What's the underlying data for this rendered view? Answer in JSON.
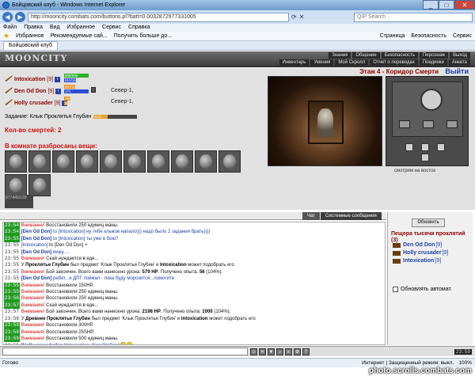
{
  "window": {
    "title": "Бойцовский клуб - Windows Internet Explorer",
    "address": "http://mooncity.combats.com/buttons.pl?batt=0.0032872977331005",
    "search_placeholder": "QIP Search",
    "menu": [
      "Файл",
      "Правка",
      "Вид",
      "Избранное",
      "Сервис",
      "Справка"
    ],
    "favorites": [
      "Избранное",
      "Рекомендуемые сай...",
      "Получить больше до..."
    ],
    "tab": "Бойцовский клуб",
    "cmds": [
      "Страница",
      "Безопасность",
      "Сервис"
    ]
  },
  "game": {
    "logo": "MOONCITY",
    "menu_row1": [
      "Знания",
      "Общение",
      "Безопасность",
      "Персонаж",
      "Выход"
    ],
    "menu_row2": [
      "Инвентарь",
      "Умения",
      "Мой Скролл",
      "Отчет о переводах",
      "Поединки",
      "Анкета"
    ],
    "location": "Этаж 4 - Коридор Смерти",
    "exit": "Выйти",
    "players": [
      {
        "name": "Intoxication",
        "level": "[9]",
        "hp": "899/899",
        "mp": "910/1915",
        "hp_pct": 100,
        "mp_pct": 48,
        "loc": ""
      },
      {
        "name": "Den Od Don",
        "level": "[9]",
        "hp": "602/1339",
        "mp": "171",
        "hp_pct": 45,
        "mp_pct": 100,
        "loc": "Север-1,"
      },
      {
        "name": "Holly crusader",
        "level": "[9]",
        "hp": "363/1400",
        "mp": "257/1800",
        "hp_pct": 26,
        "mp_pct": 14,
        "loc": "Север-1,"
      }
    ],
    "task_label": "Задание: Клык Проклятья Глубин",
    "task_progress": "5/15",
    "task_pct": 33,
    "deaths": "Кол-во смертей: 2",
    "scattered": "В комнате разбросаны вещи:",
    "item_count": 12,
    "coin_text": "977445/129",
    "facing": "смотрим на восток"
  },
  "chat": {
    "tabs": [
      "Чат",
      "Системные сообщения"
    ],
    "lines": [
      {
        "ts": "23:54",
        "g": true,
        "parts": [
          [
            "warn",
            "Внимание! "
          ],
          [
            "msgdark",
            "Восстановили 250 единиц маны."
          ]
        ]
      },
      {
        "ts": "23:54",
        "g": true,
        "parts": [
          [
            "nick",
            "[Den Od Don]"
          ],
          [
            "to",
            " to [Intoxication]"
          ],
          [
            "msgblue",
            " ну тебе клыков напало))) надо было 2 задания брать))))"
          ]
        ]
      },
      {
        "ts": "23:55",
        "g": true,
        "parts": [
          [
            "nick",
            "[Den Od Don]"
          ],
          [
            "to",
            " to [Intoxication]"
          ],
          [
            "msgblue",
            " ты уже в бою?"
          ]
        ]
      },
      {
        "ts": "23:55",
        "g": false,
        "parts": [
          [
            "to",
            "[Intoxication]"
          ],
          [
            "msgdark",
            " to [Den Od Don] +"
          ]
        ]
      },
      {
        "ts": "23:55",
        "g": false,
        "parts": [
          [
            "nick",
            "[Den Od Don]"
          ],
          [
            "msgblue",
            " вижу....."
          ]
        ]
      },
      {
        "ts": "23:55",
        "g": false,
        "parts": [
          [
            "warn",
            "Внимание! "
          ],
          [
            "msgdark",
            "Скай нуждается в еде..."
          ]
        ]
      },
      {
        "ts": "23:55",
        "g": false,
        "parts": [
          [
            "msgdark",
            "У "
          ],
          [
            "bold",
            "Проклятье Глубин"
          ],
          [
            "msgdark",
            " был предмет 'Клык Проклятья Глубин' и "
          ],
          [
            "bold",
            "Intoxication"
          ],
          [
            "msgdark",
            " может подобрать его"
          ]
        ]
      },
      {
        "ts": "23:55",
        "g": false,
        "parts": [
          [
            "warn",
            "Внимание! "
          ],
          [
            "msgdark",
            "Бой закончен. Всего вами нанесено урона: "
          ],
          [
            "bold",
            "579 HP"
          ],
          [
            "msgdark",
            ". Получено опыта: "
          ],
          [
            "bold",
            "56"
          ],
          [
            "msgdark",
            " (104%)."
          ]
        ]
      },
      {
        "ts": "23:55",
        "g": false,
        "parts": [
          [
            "nick",
            "[Den Od Don]"
          ],
          [
            "msgblue",
            " ребят...я ДПГ поймал - пока буду морозится...помогите"
          ]
        ]
      },
      {
        "ts": "23:55",
        "g": true,
        "parts": [
          [
            "warn",
            "Внимание! "
          ],
          [
            "msgdark",
            "Восстановили 150HP."
          ]
        ]
      },
      {
        "ts": "23:55",
        "g": true,
        "parts": [
          [
            "warn",
            "Внимание! "
          ],
          [
            "msgdark",
            "Восстановили 250 единиц маны."
          ]
        ]
      },
      {
        "ts": "23:56",
        "g": true,
        "parts": [
          [
            "warn",
            "Внимание! "
          ],
          [
            "msgdark",
            "Восстановили 250 единиц маны."
          ]
        ]
      },
      {
        "ts": "23:57",
        "g": true,
        "parts": [
          [
            "warn",
            "Внимание! "
          ],
          [
            "msgdark",
            "Скай нуждается в еде..."
          ]
        ]
      },
      {
        "ts": "23:57",
        "g": false,
        "parts": [
          [
            "warn",
            "Внимание! "
          ],
          [
            "msgdark",
            "Бой закончен. Всего вами нанесено урона: "
          ],
          [
            "bold",
            "2198 HP"
          ],
          [
            "msgdark",
            ". Получено опыта: "
          ],
          [
            "bold",
            "1000"
          ],
          [
            "msgdark",
            " (104%)."
          ]
        ]
      },
      {
        "ts": "23:58",
        "g": false,
        "parts": [
          [
            "msgdark",
            "У "
          ],
          [
            "bold",
            "Древнее Проклятье Глубин"
          ],
          [
            "msgdark",
            " был предмет 'Клык Проклятья Глубин' и "
          ],
          [
            "bold",
            "Intoxication"
          ],
          [
            "msgdark",
            " может подобрать его"
          ]
        ]
      },
      {
        "ts": "23:58",
        "g": true,
        "parts": [
          [
            "warn",
            "Внимание! "
          ],
          [
            "msgdark",
            "Восстановили 300HP."
          ]
        ]
      },
      {
        "ts": "23:58",
        "g": true,
        "parts": [
          [
            "warn",
            "Внимание! "
          ],
          [
            "msgdark",
            "Восстановили 25SHP."
          ]
        ]
      },
      {
        "ts": "23:59",
        "g": true,
        "parts": [
          [
            "warn",
            "Внимание! "
          ],
          [
            "msgdark",
            "Восстановили 500 единиц маны."
          ]
        ]
      },
      {
        "ts": "23:59",
        "g": false,
        "parts": [
          [
            "nick",
            "[Holly crusader]"
          ],
          [
            "to",
            " to [Intoxication, Den Od Don]"
          ],
          [
            "smile",
            ""
          ]
        ]
      },
      {
        "ts": "23:59",
        "g": true,
        "parts": [
          [
            "nick",
            "[Den Od Don]"
          ],
          [
            "to",
            " to [Intoxication, Holly crusader]"
          ],
          [
            "msgblue",
            " до чего же приятно играть с адекватными людьми...))))) пасиб))"
          ]
        ]
      },
      {
        "ts": "23:59",
        "g": false,
        "parts": [
          [
            "to",
            "[Intoxication]"
          ],
          [
            "msgdark",
            " to [Holly crusader, Den Od Don] 14 шт)"
          ]
        ]
      }
    ]
  },
  "room": {
    "refresh": "Обновить",
    "title": "Пещера тысячи проклятий (3)",
    "players": [
      {
        "name": "Den Od Don",
        "level": "[9]"
      },
      {
        "name": "Holly crusader",
        "level": "[9]"
      },
      {
        "name": "Intoxication",
        "level": "[9]"
      }
    ],
    "auto_update": "Обновлять автомат."
  },
  "bottom": {
    "clock": "23:59",
    "status_left": "Готово",
    "status_right": "Интернет | Защищенный режим: выкл.",
    "zoom": "100%",
    "watermark": "photo.scrolls.combats.com"
  }
}
